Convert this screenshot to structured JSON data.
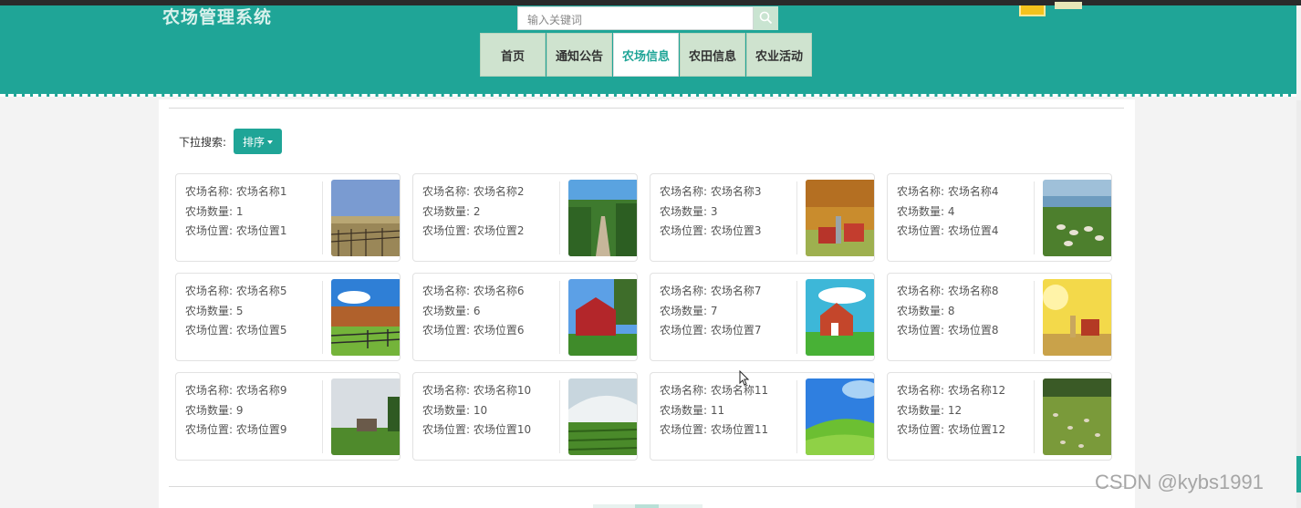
{
  "header": {
    "site_title": "农场管理系统",
    "search_placeholder": "输入关键词"
  },
  "nav": [
    {
      "label": "首页",
      "active": false
    },
    {
      "label": "通知公告",
      "active": false
    },
    {
      "label": "农场信息",
      "active": true
    },
    {
      "label": "农田信息",
      "active": false
    },
    {
      "label": "农业活动",
      "active": false
    }
  ],
  "filter": {
    "label": "下拉搜索:",
    "sort_label": "排序"
  },
  "cards": [
    {
      "name": "农场名称: 农场名称1",
      "count": "农场数量: 1",
      "location": "农场位置: 农场位置1",
      "image": "farm-fence-field"
    },
    {
      "name": "农场名称: 农场名称2",
      "count": "农场数量: 2",
      "location": "农场位置: 农场位置2",
      "image": "cornfield-path"
    },
    {
      "name": "农场名称: 农场名称3",
      "count": "农场数量: 3",
      "location": "农场位置: 农场位置3",
      "image": "autumn-barn"
    },
    {
      "name": "农场名称: 农场名称4",
      "count": "农场数量: 4",
      "location": "农场位置: 农场位置4",
      "image": "sheep-lake"
    },
    {
      "name": "农场名称: 农场名称5",
      "count": "农场数量: 5",
      "location": "农场位置: 农场位置5",
      "image": "fence-pasture"
    },
    {
      "name": "农场名称: 农场名称6",
      "count": "农场数量: 6",
      "location": "农场位置: 农场位置6",
      "image": "red-barn"
    },
    {
      "name": "农场名称: 农场名称7",
      "count": "农场数量: 7",
      "location": "农场位置: 农场位置7",
      "image": "red-house"
    },
    {
      "name": "农场名称: 农场名称8",
      "count": "农场数量: 8",
      "location": "农场位置: 农场位置8",
      "image": "sunset-silo"
    },
    {
      "name": "农场名称: 农场名称9",
      "count": "农场数量: 9",
      "location": "农场位置: 农场位置9",
      "image": "grass-shed"
    },
    {
      "name": "农场名称: 农场名称10",
      "count": "农场数量: 10",
      "location": "农场位置: 农场位置10",
      "image": "greenhouse"
    },
    {
      "name": "农场名称: 农场名称11",
      "count": "农场数量: 11",
      "location": "农场位置: 农场位置11",
      "image": "green-hills"
    },
    {
      "name": "农场名称: 农场名称12",
      "count": "农场数量: 12",
      "location": "农场位置: 农场位置12",
      "image": "sheep-meadow"
    }
  ],
  "watermark": "CSDN @kybs1991",
  "colors": {
    "header": "#1fa597",
    "nav_bg": "#cfe3cf",
    "active_text": "#1fa597",
    "sort_button": "#1fa597"
  }
}
